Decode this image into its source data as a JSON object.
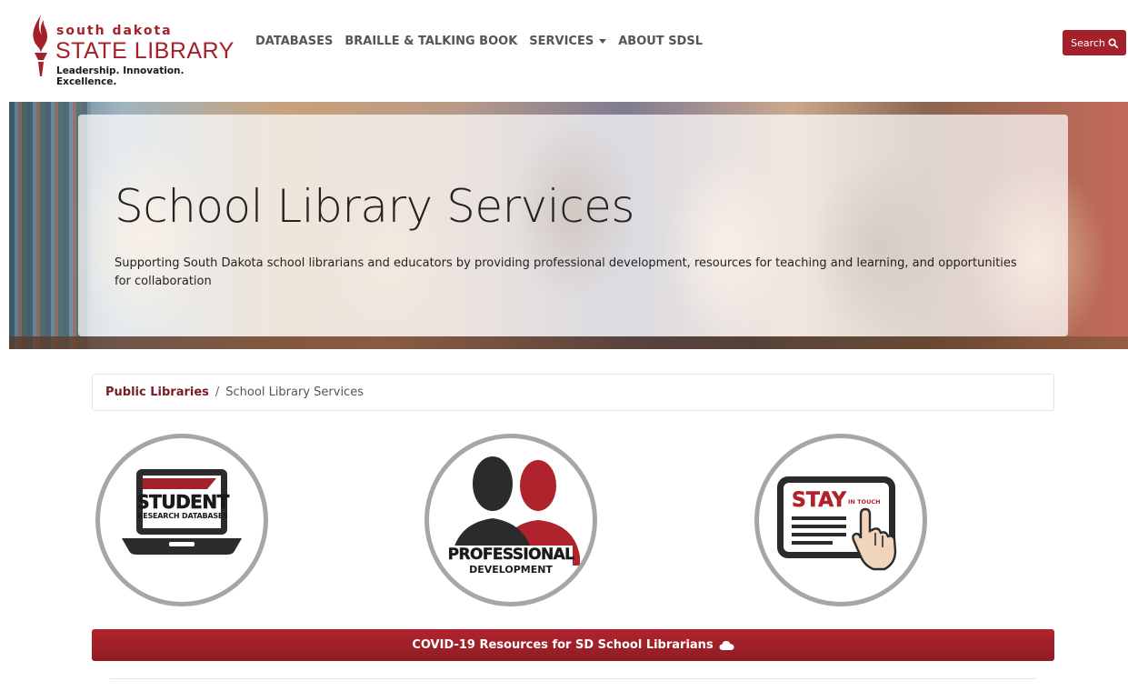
{
  "header": {
    "logo": {
      "line1": "south dakota",
      "line2": "STATE LIBRARY",
      "tagline": "Leadership. Innovation. Excellence."
    },
    "nav": [
      {
        "label": "DATABASES"
      },
      {
        "label": "BRAILLE & TALKING BOOK"
      },
      {
        "label": "SERVICES",
        "has_dropdown": true
      },
      {
        "label": "ABOUT SDSL"
      }
    ],
    "search_label": "Search"
  },
  "hero": {
    "title": "School Library Services",
    "subtitle": "Supporting South Dakota school librarians and educators by providing professional development, resources for teaching and learning, and opportunities for collaboration"
  },
  "breadcrumb": {
    "parent": "Public Libraries",
    "separator": "/",
    "current": "School Library Services"
  },
  "tiles": [
    {
      "line1": "STUDENT",
      "line2": "RESEARCH DATABASES",
      "icon": "laptop-icon"
    },
    {
      "line1": "PROFESSIONAL",
      "line2": "DEVELOPMENT",
      "icon": "people-icon"
    },
    {
      "line1": "STAY",
      "line2": "IN TOUCH",
      "icon": "tablet-touch-icon"
    }
  ],
  "covid_button": {
    "label": "COVID-19 Resources for SD School Librarians",
    "icon": "cloud-icon"
  },
  "colors": {
    "brand_red": "#a4202a",
    "breadcrumb_link": "#7a1a22",
    "tile_border": "#a6a6a6"
  }
}
